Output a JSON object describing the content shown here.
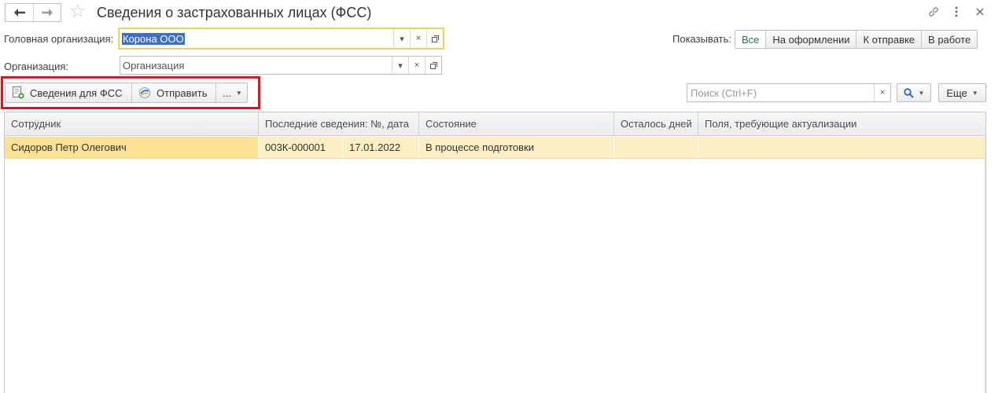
{
  "header": {
    "title": "Сведения о застрахованных лицах (ФСС)"
  },
  "form": {
    "head_org_label": "Головная организация:",
    "head_org_value": "Корона ООО",
    "org_label": "Организация:",
    "org_placeholder": "Организация",
    "show_label": "Показывать:",
    "filters": [
      "Все",
      "На оформлении",
      "К отправке",
      "В работе"
    ],
    "active_filter": "Все"
  },
  "commands": {
    "create_label": "Сведения для ФСС",
    "send_label": "Отправить",
    "more_label": "...",
    "search_placeholder": "Поиск (Ctrl+F)",
    "more_menu_label": "Еще"
  },
  "table": {
    "columns": [
      "Сотрудник",
      "Последние сведения: №, дата",
      "Состояние",
      "Осталось дней",
      "Поля, требующие актуализации"
    ],
    "rows": [
      {
        "employee": "Сидоров Петр Олегович",
        "number": "003К-000001",
        "date": "17.01.2022",
        "state": "В процессе подготовки",
        "days_left": "",
        "fields": ""
      }
    ]
  },
  "colors": {
    "accent_green": "#2b7a3a",
    "highlight_red": "#e0131e",
    "selected_row": "#fcefc4",
    "focus_yellow": "#f0c841"
  }
}
